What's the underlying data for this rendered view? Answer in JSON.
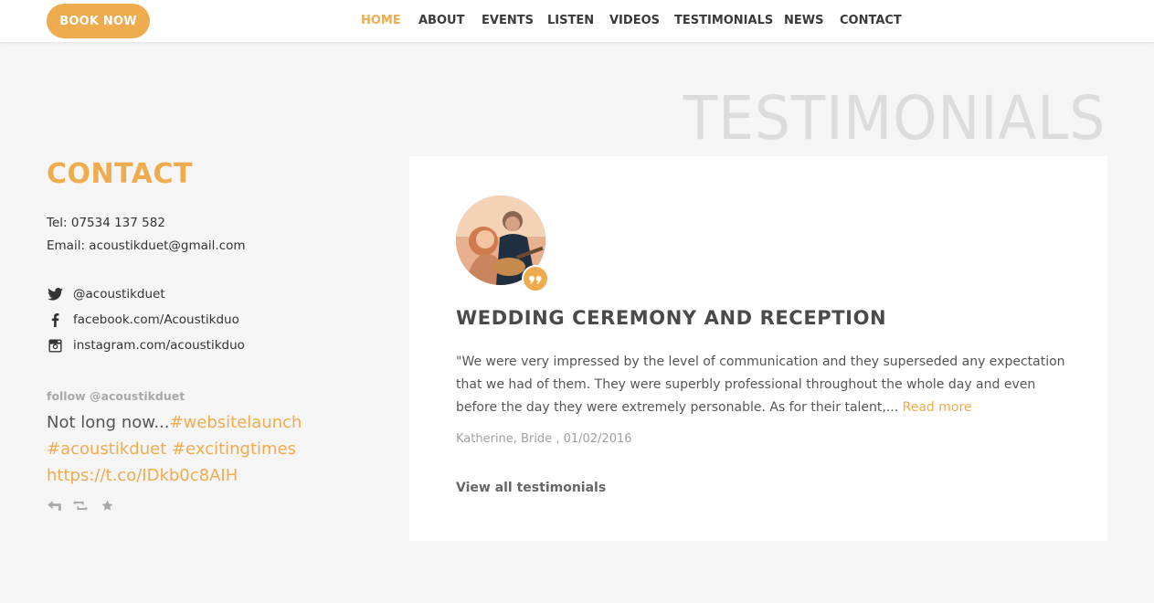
{
  "header": {
    "book_now": "BOOK NOW",
    "nav": [
      {
        "label": "HOME",
        "active": true
      },
      {
        "label": "ABOUT",
        "active": false
      },
      {
        "label": "EVENTS",
        "active": false
      },
      {
        "label": "LISTEN",
        "active": false
      },
      {
        "label": "VIDEOS",
        "active": false
      },
      {
        "label": "TESTIMONIALS",
        "active": false
      },
      {
        "label": "NEWS",
        "active": false
      },
      {
        "label": "CONTACT",
        "active": false
      }
    ]
  },
  "section_heading": "TESTIMONIALS",
  "contact": {
    "title": "CONTACT",
    "tel": "Tel: 07534 137 582",
    "email": "Email: acoustikduet@gmail.com",
    "social": {
      "twitter": "@acoustikduet",
      "facebook": "facebook.com/Acoustikduo",
      "instagram": "instagram.com/acoustikduo"
    },
    "follow": "follow @acoustikduet",
    "tweet": {
      "text": "Not long now...",
      "hashtag1": "#websitelaunch",
      "hashtag2": "#acoustikduet",
      "hashtag3": "#excitingtimes",
      "link": "https://t.co/IDkb0c8AIH"
    }
  },
  "testimonial": {
    "title": "WEDDING CEREMONY AND RECEPTION",
    "body": "\"We were very impressed by the level of communication and they superseded any expectation that we had of them. They were superbly professional throughout the whole day and even before the day they were extremely personable. As for their talent,... ",
    "read_more": "Read more",
    "author": "Katherine, Bride , 01/02/2016",
    "view_all": "View all testimonials"
  },
  "colors": {
    "accent": "#efac4e",
    "background": "#f5f5f5",
    "card": "#ffffff",
    "heading_watermark": "#dcdcdc"
  },
  "icons": [
    "twitter-icon",
    "facebook-icon",
    "instagram-icon",
    "reply-icon",
    "retweet-icon",
    "favorite-icon",
    "quote-icon"
  ]
}
